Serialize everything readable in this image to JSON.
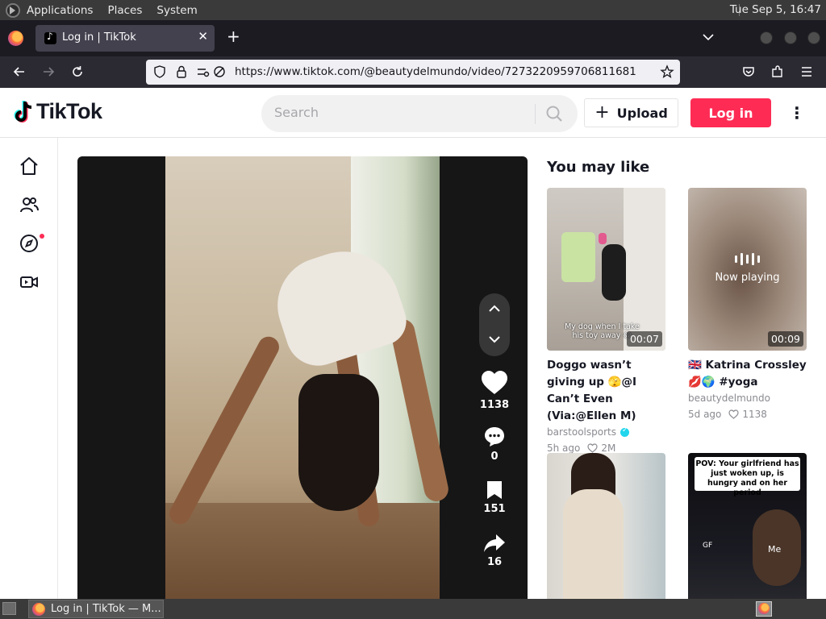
{
  "os": {
    "menus": [
      "Applications",
      "Places",
      "System"
    ],
    "clock": "Tue Sep  5, 16:47"
  },
  "browser": {
    "tab_title": "Log in | TikTok",
    "url": "https://www.tiktok.com/@beautydelmundo/video/7273220959706811681"
  },
  "tiktok": {
    "logo_text": "TikTok",
    "search_placeholder": "Search",
    "upload_label": "Upload",
    "login_label": "Log in",
    "video_actions": {
      "likes": "1138",
      "comments": "0",
      "saves": "151",
      "shares": "16"
    },
    "recommendations_title": "You may like",
    "recommendations": [
      {
        "title": "Doggo wasn’t giving up 🫣@I Can’t Even (Via:@Ellen M)",
        "author": "barstoolsports",
        "verified": true,
        "age": "5h ago",
        "likes": "2M",
        "duration": "00:07",
        "thumb_caption": "My dog when I take his toy away 😂"
      },
      {
        "title": "🇬🇧 Katrina Crossley 💋🌍 #yoga",
        "author": "beautydelmundo",
        "verified": false,
        "age": "5d ago",
        "likes": "1138",
        "duration": "00:09",
        "status": "Now playing"
      },
      {
        "title": "",
        "author": "",
        "duration": ""
      },
      {
        "title": "",
        "author": "",
        "thumb_caption": "POV: Your girlfriend has just woken up, is hungry and on her period",
        "thumb_label_left": "GF",
        "thumb_label_right": "Me"
      }
    ]
  },
  "taskbar": {
    "window_title": "Log in | TikTok — M..."
  },
  "colors": {
    "brand_red": "#fe2c55",
    "firefox_dark": "#1c1b22",
    "text_primary": "#161823"
  }
}
